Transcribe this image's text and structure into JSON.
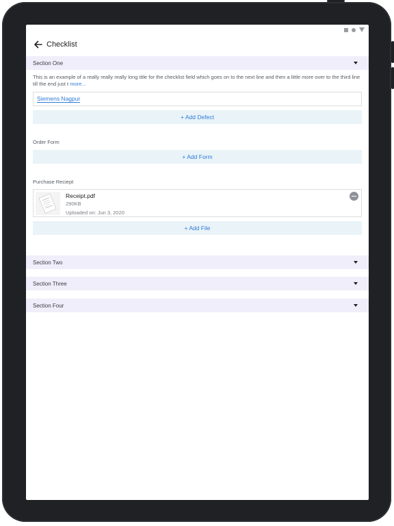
{
  "app": {
    "title": "Checklist"
  },
  "sections": [
    {
      "label": "Section One",
      "expanded": true
    },
    {
      "label": "Section Two",
      "expanded": false
    },
    {
      "label": "Section Three",
      "expanded": false
    },
    {
      "label": "Section Four",
      "expanded": false
    }
  ],
  "section_one": {
    "description": "This is an example of a really really really long title for the checklist field which goes on to the next line and then a little more over to the third line till the end just t",
    "more_label": "more...",
    "field_value": "Siemens Nagpur",
    "add_defect_label": "+ Add Defect",
    "order_form_label": "Order Form",
    "add_form_label": "+ Add Form",
    "purchase_receipt_label": "Purchase Reciept",
    "file": {
      "name": "Receipt.pdf",
      "size": "290KB",
      "uploaded": "Uploaded on: Jun 3, 2020"
    },
    "add_file_label": "+ Add File"
  },
  "icons": {
    "back": "arrow-left-icon",
    "caret": "caret-down-icon",
    "remove": "minus-circle-icon"
  },
  "colors": {
    "accent": "#2f7bd6",
    "section_bg": "#f1eefb",
    "button_bg": "#e9f3f8",
    "device_frame": "#1f2124"
  }
}
